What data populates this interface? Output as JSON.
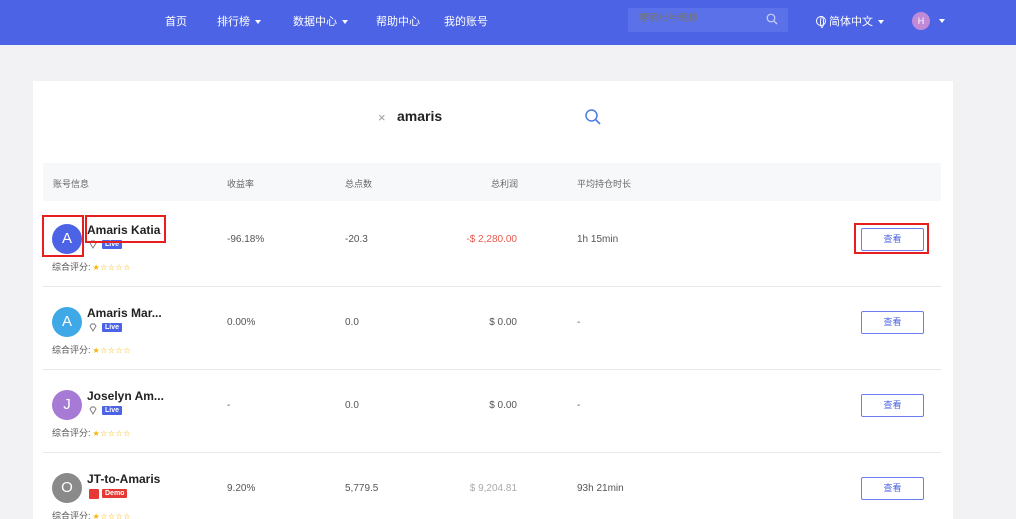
{
  "nav": {
    "home": "首页",
    "rankings": "排行榜",
    "data_center": "数据中心",
    "help_center": "帮助中心",
    "my_account": "我的账号",
    "search_placeholder": "搜索账号昵称",
    "language": "简体中文",
    "user_initial": "H"
  },
  "search": {
    "term": "amaris",
    "clear_icon": "×"
  },
  "table": {
    "headers": {
      "account": "账号信息",
      "return_rate": "收益率",
      "points": "总点数",
      "profit": "总利润",
      "avg_hold": "平均持仓时长"
    },
    "rating_label": "综合评分:",
    "rating_stars": "★☆☆☆☆",
    "view_label": "查看",
    "rows": [
      {
        "initial": "A",
        "name": "Amaris Katia",
        "type": "Live",
        "return_rate": "-96.18%",
        "points": "-20.3",
        "profit": "-$ 2,280.00",
        "avg_hold": "1h 15min",
        "avatar_color": "#4c63e6",
        "profit_color": "#e8594f"
      },
      {
        "initial": "A",
        "name": "Amaris Mar...",
        "type": "Live",
        "return_rate": "0.00%",
        "points": "0.0",
        "profit": "$ 0.00",
        "avg_hold": "-",
        "avatar_color": "#3fa9e8",
        "profit_color": "#555555"
      },
      {
        "initial": "J",
        "name": "Joselyn Am...",
        "type": "Live",
        "return_rate": "-",
        "points": "0.0",
        "profit": "$ 0.00",
        "avg_hold": "-",
        "avatar_color": "#a77ad6",
        "profit_color": "#555555"
      },
      {
        "initial": "O",
        "name": "JT-to-Amaris",
        "type": "Demo",
        "return_rate": "9.20%",
        "points": "5,779.5",
        "profit": "$ 9,204.81",
        "avg_hold": "93h 21min",
        "avatar_color": "#8a8a8a",
        "profit_color": "#aaaaaa"
      }
    ]
  },
  "colors": {
    "brand": "#4c63e6",
    "highlight": "#e61e1e"
  }
}
